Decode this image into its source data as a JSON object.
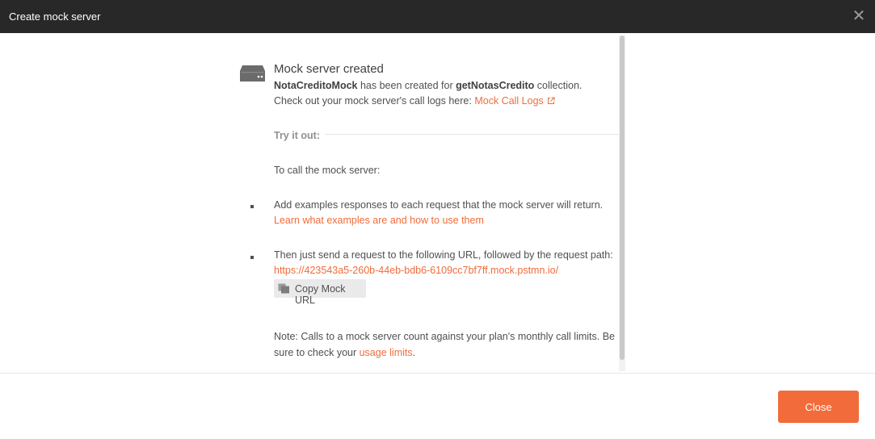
{
  "window": {
    "title": "Create mock server",
    "close_glyph": "✕",
    "close_icon": "close-icon"
  },
  "created": {
    "icon": "server-icon",
    "heading": "Mock server created",
    "mock_name": "NotaCreditoMock",
    "created_text_mid": " has been created for ",
    "collection_name": "getNotasCredito",
    "created_text_end": " collection.",
    "logs_prefix": "Check out your mock server's call logs here: ",
    "logs_link": "Mock Call Logs",
    "logs_link_icon": "external-link-icon"
  },
  "try_it": {
    "label": "Try it out:",
    "intro": "To call the mock server:",
    "step1_text": "Add examples responses to each request that the mock server will return.",
    "step1_link": " Learn what examples are and how to use them",
    "step2_text": "Then just send a request to the following URL, followed by the request path:",
    "mock_url": "https://423543a5-260b-44eb-bdb6-6109cc7bf7ff.mock.pstmn.io/",
    "copy_button": "Copy Mock URL",
    "copy_icon": "copy-icon"
  },
  "note": {
    "line1": "Note: Calls to a mock server count against your plan's monthly call limits. Be",
    "line2_prefix": "sure to check your ",
    "line2_link": "usage limits",
    "line2_suffix": "."
  },
  "footer": {
    "close_button": "Close"
  },
  "colors": {
    "title_bar": "#282828",
    "accent": "#f26b3a",
    "text": "#505050"
  }
}
